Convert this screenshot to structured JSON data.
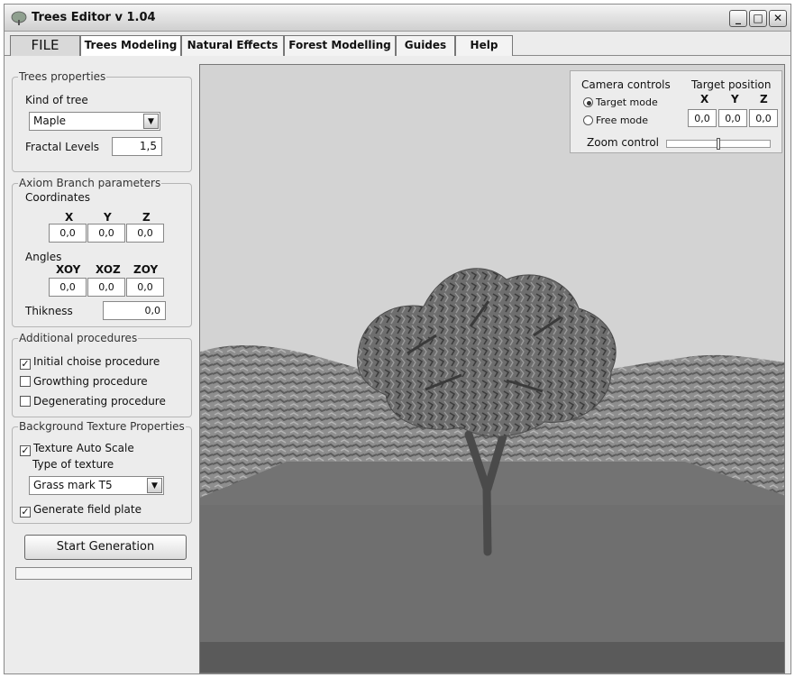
{
  "window": {
    "title": "Trees Editor v 1.04",
    "controls": {
      "minimize": "_",
      "maximize": "□",
      "close": "✕"
    }
  },
  "menu": {
    "file": "FILE",
    "tabs": [
      "Trees Modeling",
      "Natural Effects",
      "Forest Modelling",
      "Guides",
      "Help"
    ],
    "active_tab": "Trees Modeling"
  },
  "trees_properties": {
    "legend": "Trees properties",
    "kind_label": "Kind of tree",
    "kind_value": "Maple",
    "fractal_label": "Fractal Levels",
    "fractal_value": "1,5"
  },
  "axiom": {
    "legend": "Axiom Branch parameters",
    "coordinates_label": "Coordinates",
    "coord_headers": [
      "X",
      "Y",
      "Z"
    ],
    "coord_values": [
      "0,0",
      "0,0",
      "0,0"
    ],
    "angles_label": "Angles",
    "angle_headers": [
      "XOY",
      "XOZ",
      "ZOY"
    ],
    "angle_values": [
      "0,0",
      "0,0",
      "0,0"
    ],
    "thickness_label": "Thikness",
    "thickness_value": "0,0"
  },
  "procedures": {
    "legend": "Additional procedures",
    "items": [
      {
        "label": "Initial choise procedure",
        "checked": true
      },
      {
        "label": "Growthing procedure",
        "checked": false
      },
      {
        "label": "Degenerating procedure",
        "checked": false
      }
    ]
  },
  "background": {
    "legend": "Background Texture Properties",
    "auto_scale_label": "Texture Auto Scale",
    "auto_scale_checked": true,
    "type_label": "Type of texture",
    "type_value": "Grass mark T5",
    "field_plate_label": "Generate field plate",
    "field_plate_checked": true
  },
  "start_button": "Start Generation",
  "progress": {
    "value": 0
  },
  "camera": {
    "controls_label": "Camera controls",
    "target_label": "Target position",
    "modes": [
      {
        "label": "Target mode",
        "selected": true
      },
      {
        "label": "Free mode",
        "selected": false
      }
    ],
    "axis_headers": [
      "X",
      "Y",
      "Z"
    ],
    "target_values": [
      "0,0",
      "0,0",
      "0,0"
    ],
    "zoom_label": "Zoom control",
    "zoom_level": 0.5
  },
  "icons": {
    "app": "tree-icon",
    "check": "✓"
  },
  "colors": {
    "sky": "#d3d3d3",
    "hills": "#8c8c8c",
    "ground": "#6e6e6e",
    "trunk": "#4a4a4a",
    "foliage": "#5e5e5e"
  }
}
